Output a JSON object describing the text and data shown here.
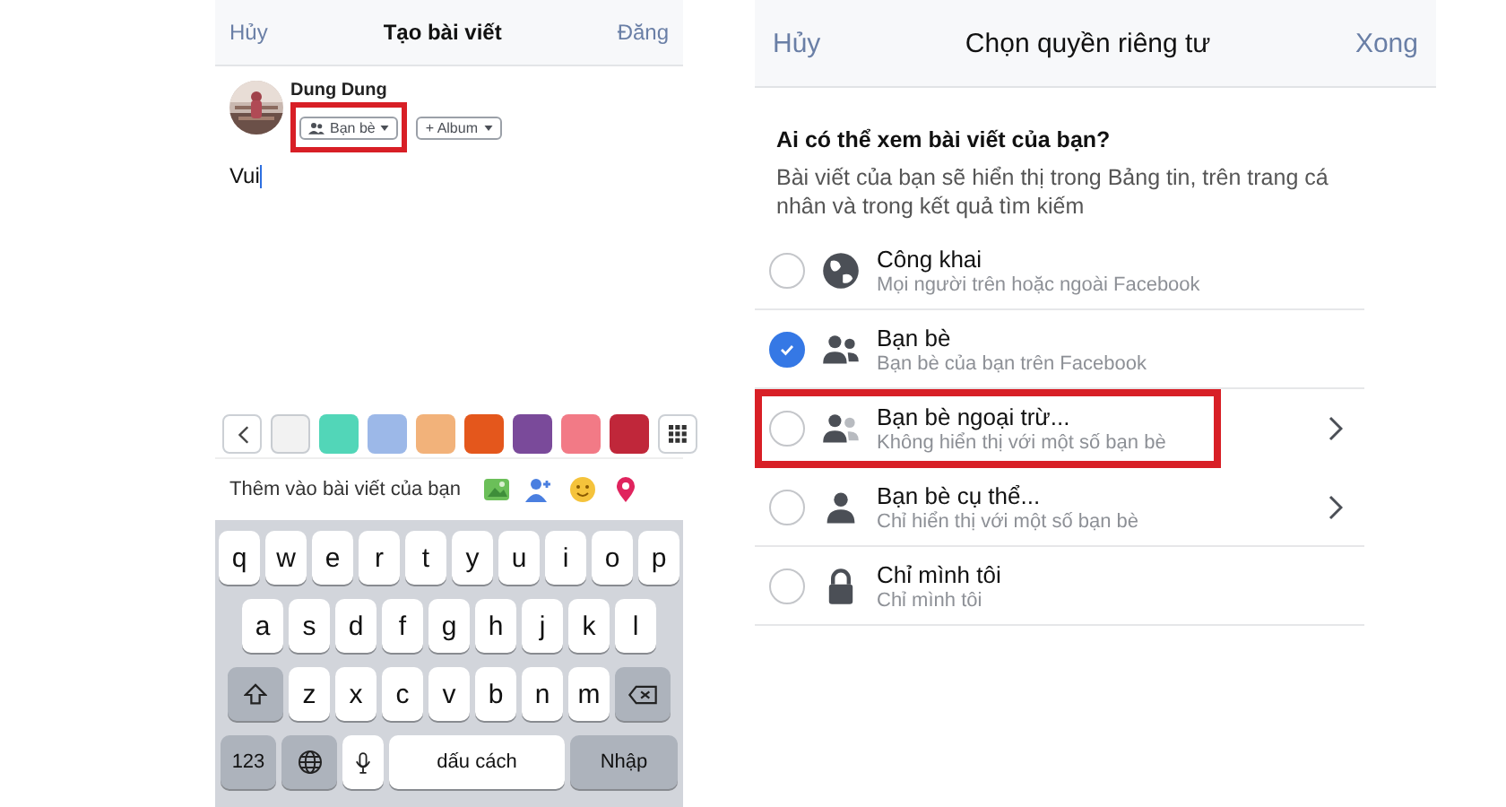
{
  "compose": {
    "header": {
      "cancel": "Hủy",
      "title": "Tạo bài viết",
      "post": "Đăng"
    },
    "author": {
      "name": "Dung Dung"
    },
    "audience_button": {
      "label": "Bạn bè",
      "highlighted": true
    },
    "album_button": {
      "label": "+ Album"
    },
    "post_text": "Vui",
    "background_swatches": [
      {
        "color": "#f2f2f2",
        "selected": true
      },
      {
        "color": "#52d6b8",
        "selected": false
      },
      {
        "color": "#9cb8e8",
        "selected": false
      },
      {
        "color": "#f2b27a",
        "selected": false
      },
      {
        "color": "#e4571c",
        "selected": false
      },
      {
        "color": "#7a4a9a",
        "selected": false
      },
      {
        "color": "#f27a86",
        "selected": false
      },
      {
        "color": "#c0273a",
        "selected": false
      }
    ],
    "add_to_post": {
      "label": "Thêm vào bài viết của bạn"
    },
    "keyboard": [
      [
        {
          "kind": "letter",
          "label": "q"
        },
        {
          "kind": "letter",
          "label": "w"
        },
        {
          "kind": "letter",
          "label": "e"
        },
        {
          "kind": "letter",
          "label": "r"
        },
        {
          "kind": "letter",
          "label": "t"
        },
        {
          "kind": "letter",
          "label": "y"
        },
        {
          "kind": "letter",
          "label": "u"
        },
        {
          "kind": "letter",
          "label": "i"
        },
        {
          "kind": "letter",
          "label": "o"
        },
        {
          "kind": "letter",
          "label": "p"
        }
      ],
      [
        {
          "kind": "letter",
          "label": "a"
        },
        {
          "kind": "letter",
          "label": "s"
        },
        {
          "kind": "letter",
          "label": "d"
        },
        {
          "kind": "letter",
          "label": "f"
        },
        {
          "kind": "letter",
          "label": "g"
        },
        {
          "kind": "letter",
          "label": "h"
        },
        {
          "kind": "letter",
          "label": "j"
        },
        {
          "kind": "letter",
          "label": "k"
        },
        {
          "kind": "letter",
          "label": "l"
        }
      ],
      [
        {
          "kind": "shift"
        },
        {
          "kind": "letter",
          "label": "z"
        },
        {
          "kind": "letter",
          "label": "x"
        },
        {
          "kind": "letter",
          "label": "c"
        },
        {
          "kind": "letter",
          "label": "v"
        },
        {
          "kind": "letter",
          "label": "b"
        },
        {
          "kind": "letter",
          "label": "n"
        },
        {
          "kind": "letter",
          "label": "m"
        },
        {
          "kind": "backspace"
        }
      ],
      [
        {
          "kind": "numbers",
          "label": "123"
        },
        {
          "kind": "globe"
        },
        {
          "kind": "mic"
        },
        {
          "kind": "space",
          "label": "dấu cách"
        },
        {
          "kind": "return",
          "label": "Nhập"
        }
      ]
    ]
  },
  "privacy": {
    "header": {
      "cancel": "Hủy",
      "title": "Chọn quyền riêng tư",
      "done": "Xong"
    },
    "question": "Ai có thể xem bài viết của bạn?",
    "description": "Bài viết của bạn sẽ hiển thị trong Bảng tin, trên trang cá nhân và trong kết quả tìm kiếm",
    "options": [
      {
        "kind": "globe",
        "title": "Công khai",
        "subtitle": "Mọi người trên hoặc ngoài Facebook",
        "selected": false,
        "chevron": false,
        "highlighted": false
      },
      {
        "kind": "friends",
        "title": "Bạn bè",
        "subtitle": "Bạn bè của bạn trên Facebook",
        "selected": true,
        "chevron": false,
        "highlighted": false
      },
      {
        "kind": "friends-except",
        "title": "Bạn bè ngoại trừ...",
        "subtitle": "Không hiển thị với một số bạn bè",
        "selected": false,
        "chevron": true,
        "highlighted": true
      },
      {
        "kind": "person",
        "title": "Bạn bè cụ thể...",
        "subtitle": "Chỉ hiển thị với một số bạn bè",
        "selected": false,
        "chevron": true,
        "highlighted": false
      },
      {
        "kind": "lock",
        "title": "Chỉ mình tôi",
        "subtitle": "Chỉ mình tôi",
        "selected": false,
        "chevron": false,
        "highlighted": false
      }
    ]
  }
}
